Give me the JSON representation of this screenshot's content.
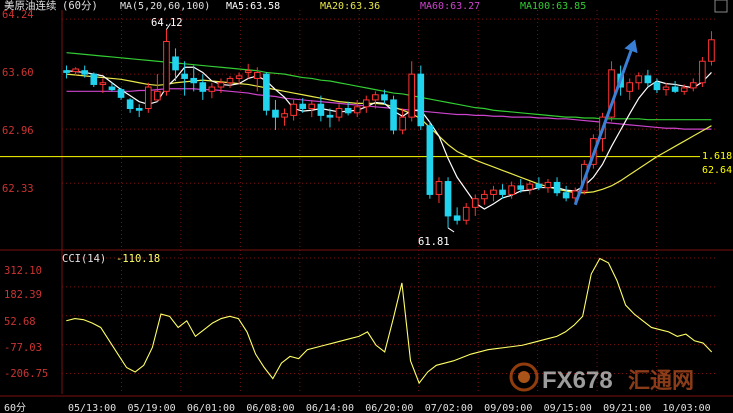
{
  "header": {
    "symbol": "美原油连续",
    "period": "(60分)",
    "ma_params": "MA(5,20,60,100)",
    "ma5": "MA5:63.58",
    "ma20": "MA20:63.36",
    "ma60": "MA60:63.27",
    "ma100": "MA100:63.85"
  },
  "colors": {
    "ma5": "#ffffff",
    "ma20": "#e8e84a",
    "ma60": "#cc44cc",
    "ma100": "#33cc33",
    "up": "#ff3333",
    "down": "#22d3ee",
    "grid": "#7a1010",
    "axis_text": "#cc3333",
    "cci": "#ffff66",
    "level_line": "#ffff00",
    "arrow": "#3a7fd6"
  },
  "price_axis": {
    "ticks": [
      "64.24",
      "63.60",
      "62.96",
      "62.33"
    ],
    "range": [
      61.6,
      64.3
    ]
  },
  "annotations": {
    "high_label": "64.12",
    "low_label": "61.81",
    "level_value": "1.618",
    "level_price": "62.64"
  },
  "cci": {
    "title": "CCI(14)",
    "value": "-110.18",
    "ticks": [
      "312.10",
      "182.39",
      "52.68",
      "-77.03",
      "-206.75"
    ],
    "range": [
      -290,
      330
    ]
  },
  "period_label": "60分",
  "watermark": {
    "brand": "FX678",
    "cn": "汇通网"
  },
  "time_axis": [
    "05/13:00",
    "05/19:00",
    "06/01:00",
    "06/08:00",
    "06/14:00",
    "06/20:00",
    "07/02:00",
    "09/09:00",
    "09/15:00",
    "09/21:00",
    "10/03:00"
  ],
  "chart_data": {
    "type": "candlestick",
    "candles": [
      {
        "o": 63.64,
        "h": 63.7,
        "l": 63.55,
        "c": 63.62
      },
      {
        "o": 63.63,
        "h": 63.68,
        "l": 63.58,
        "c": 63.66
      },
      {
        "o": 63.64,
        "h": 63.7,
        "l": 63.56,
        "c": 63.6
      },
      {
        "o": 63.6,
        "h": 63.62,
        "l": 63.45,
        "c": 63.48
      },
      {
        "o": 63.48,
        "h": 63.55,
        "l": 63.38,
        "c": 63.5
      },
      {
        "o": 63.45,
        "h": 63.5,
        "l": 63.4,
        "c": 63.42
      },
      {
        "o": 63.42,
        "h": 63.44,
        "l": 63.3,
        "c": 63.33
      },
      {
        "o": 63.3,
        "h": 63.32,
        "l": 63.15,
        "c": 63.2
      },
      {
        "o": 63.2,
        "h": 63.25,
        "l": 63.1,
        "c": 63.18
      },
      {
        "o": 63.2,
        "h": 63.5,
        "l": 63.15,
        "c": 63.45
      },
      {
        "o": 63.3,
        "h": 63.6,
        "l": 63.28,
        "c": 63.4
      },
      {
        "o": 63.4,
        "h": 64.12,
        "l": 63.35,
        "c": 63.98
      },
      {
        "o": 63.8,
        "h": 63.9,
        "l": 63.52,
        "c": 63.65
      },
      {
        "o": 63.6,
        "h": 63.75,
        "l": 63.35,
        "c": 63.55
      },
      {
        "o": 63.55,
        "h": 63.7,
        "l": 63.4,
        "c": 63.5
      },
      {
        "o": 63.5,
        "h": 63.6,
        "l": 63.3,
        "c": 63.4
      },
      {
        "o": 63.4,
        "h": 63.5,
        "l": 63.32,
        "c": 63.45
      },
      {
        "o": 63.45,
        "h": 63.55,
        "l": 63.38,
        "c": 63.5
      },
      {
        "o": 63.5,
        "h": 63.58,
        "l": 63.44,
        "c": 63.55
      },
      {
        "o": 63.55,
        "h": 63.62,
        "l": 63.48,
        "c": 63.58
      },
      {
        "o": 63.62,
        "h": 63.72,
        "l": 63.55,
        "c": 63.64
      },
      {
        "o": 63.55,
        "h": 63.68,
        "l": 63.4,
        "c": 63.62
      },
      {
        "o": 63.6,
        "h": 63.62,
        "l": 63.12,
        "c": 63.18
      },
      {
        "o": 63.18,
        "h": 63.3,
        "l": 62.95,
        "c": 63.1
      },
      {
        "o": 63.1,
        "h": 63.2,
        "l": 63.0,
        "c": 63.14
      },
      {
        "o": 63.12,
        "h": 63.3,
        "l": 63.06,
        "c": 63.25
      },
      {
        "o": 63.25,
        "h": 63.32,
        "l": 63.15,
        "c": 63.2
      },
      {
        "o": 63.2,
        "h": 63.3,
        "l": 63.1,
        "c": 63.25
      },
      {
        "o": 63.25,
        "h": 63.35,
        "l": 63.05,
        "c": 63.12
      },
      {
        "o": 63.12,
        "h": 63.2,
        "l": 62.98,
        "c": 63.1
      },
      {
        "o": 63.1,
        "h": 63.25,
        "l": 63.05,
        "c": 63.2
      },
      {
        "o": 63.2,
        "h": 63.28,
        "l": 63.12,
        "c": 63.15
      },
      {
        "o": 63.15,
        "h": 63.3,
        "l": 63.1,
        "c": 63.22
      },
      {
        "o": 63.22,
        "h": 63.35,
        "l": 63.15,
        "c": 63.3
      },
      {
        "o": 63.3,
        "h": 63.4,
        "l": 63.2,
        "c": 63.36
      },
      {
        "o": 63.36,
        "h": 63.42,
        "l": 63.25,
        "c": 63.3
      },
      {
        "o": 63.3,
        "h": 63.35,
        "l": 62.9,
        "c": 62.95
      },
      {
        "o": 62.95,
        "h": 63.2,
        "l": 62.9,
        "c": 63.1
      },
      {
        "o": 63.1,
        "h": 63.75,
        "l": 63.05,
        "c": 63.6
      },
      {
        "o": 63.6,
        "h": 63.7,
        "l": 62.95,
        "c": 63.0
      },
      {
        "o": 63.0,
        "h": 63.05,
        "l": 62.15,
        "c": 62.2
      },
      {
        "o": 62.2,
        "h": 62.4,
        "l": 62.1,
        "c": 62.35
      },
      {
        "o": 62.35,
        "h": 62.4,
        "l": 61.81,
        "c": 61.95
      },
      {
        "o": 61.95,
        "h": 62.05,
        "l": 61.85,
        "c": 61.9
      },
      {
        "o": 61.9,
        "h": 62.1,
        "l": 61.85,
        "c": 62.05
      },
      {
        "o": 62.05,
        "h": 62.2,
        "l": 61.95,
        "c": 62.15
      },
      {
        "o": 62.15,
        "h": 62.25,
        "l": 62.08,
        "c": 62.2
      },
      {
        "o": 62.2,
        "h": 62.3,
        "l": 62.12,
        "c": 62.25
      },
      {
        "o": 62.25,
        "h": 62.32,
        "l": 62.15,
        "c": 62.2
      },
      {
        "o": 62.2,
        "h": 62.35,
        "l": 62.15,
        "c": 62.3
      },
      {
        "o": 62.3,
        "h": 62.38,
        "l": 62.22,
        "c": 62.26
      },
      {
        "o": 62.26,
        "h": 62.35,
        "l": 62.2,
        "c": 62.32
      },
      {
        "o": 62.32,
        "h": 62.4,
        "l": 62.25,
        "c": 62.28
      },
      {
        "o": 62.28,
        "h": 62.38,
        "l": 62.22,
        "c": 62.34
      },
      {
        "o": 62.34,
        "h": 62.4,
        "l": 62.18,
        "c": 62.22
      },
      {
        "o": 62.22,
        "h": 62.3,
        "l": 62.12,
        "c": 62.16
      },
      {
        "o": 62.16,
        "h": 62.28,
        "l": 62.1,
        "c": 62.24
      },
      {
        "o": 62.24,
        "h": 62.6,
        "l": 62.2,
        "c": 62.55
      },
      {
        "o": 62.55,
        "h": 62.9,
        "l": 62.5,
        "c": 62.85
      },
      {
        "o": 62.85,
        "h": 63.15,
        "l": 62.7,
        "c": 63.1
      },
      {
        "o": 63.1,
        "h": 63.75,
        "l": 63.05,
        "c": 63.65
      },
      {
        "o": 63.6,
        "h": 63.7,
        "l": 63.35,
        "c": 63.45
      },
      {
        "o": 63.4,
        "h": 63.55,
        "l": 63.3,
        "c": 63.5
      },
      {
        "o": 63.5,
        "h": 63.62,
        "l": 63.42,
        "c": 63.58
      },
      {
        "o": 63.58,
        "h": 63.65,
        "l": 63.45,
        "c": 63.5
      },
      {
        "o": 63.5,
        "h": 63.55,
        "l": 63.38,
        "c": 63.42
      },
      {
        "o": 63.42,
        "h": 63.5,
        "l": 63.35,
        "c": 63.45
      },
      {
        "o": 63.45,
        "h": 63.52,
        "l": 63.38,
        "c": 63.4
      },
      {
        "o": 63.4,
        "h": 63.48,
        "l": 63.36,
        "c": 63.44
      },
      {
        "o": 63.44,
        "h": 63.55,
        "l": 63.4,
        "c": 63.5
      },
      {
        "o": 63.5,
        "h": 63.8,
        "l": 63.45,
        "c": 63.75
      },
      {
        "o": 63.75,
        "h": 64.1,
        "l": 63.7,
        "c": 64.0
      }
    ],
    "ma5": [
      63.64,
      63.63,
      63.62,
      63.6,
      63.58,
      63.5,
      63.42,
      63.35,
      63.28,
      63.25,
      63.28,
      63.45,
      63.55,
      63.68,
      63.68,
      63.62,
      63.52,
      63.48,
      63.47,
      63.49,
      63.55,
      63.58,
      63.52,
      63.42,
      63.33,
      63.2,
      63.17,
      63.18,
      63.2,
      63.18,
      63.16,
      63.17,
      63.18,
      63.22,
      63.27,
      63.26,
      63.17,
      63.11,
      63.18,
      63.18,
      63.04,
      62.88,
      62.62,
      62.4,
      62.25,
      62.1,
      62.03,
      62.09,
      62.16,
      62.19,
      62.24,
      62.25,
      62.28,
      62.28,
      62.28,
      62.25,
      62.24,
      62.3,
      62.4,
      62.55,
      62.76,
      62.95,
      63.14,
      63.32,
      63.45,
      63.52,
      63.49,
      63.48,
      63.46,
      63.44,
      63.51,
      63.62
    ],
    "ma20": [
      63.6,
      63.59,
      63.58,
      63.57,
      63.56,
      63.55,
      63.54,
      63.52,
      63.5,
      63.48,
      63.47,
      63.48,
      63.5,
      63.51,
      63.52,
      63.53,
      63.52,
      63.51,
      63.5,
      63.49,
      63.48,
      63.46,
      63.44,
      63.42,
      63.4,
      63.38,
      63.36,
      63.34,
      63.32,
      63.3,
      63.28,
      63.27,
      63.26,
      63.26,
      63.26,
      63.25,
      63.22,
      63.18,
      63.14,
      63.08,
      62.98,
      62.88,
      62.78,
      62.7,
      62.65,
      62.6,
      62.56,
      62.52,
      62.48,
      62.44,
      62.4,
      62.36,
      62.32,
      62.29,
      62.26,
      62.24,
      62.22,
      62.22,
      62.23,
      62.26,
      62.3,
      62.36,
      62.43,
      62.5,
      62.57,
      62.64,
      62.7,
      62.76,
      62.82,
      62.88,
      62.94,
      63.0
    ],
    "ma60": [
      63.4,
      63.4,
      63.4,
      63.4,
      63.4,
      63.4,
      63.4,
      63.4,
      63.41,
      63.41,
      63.42,
      63.43,
      63.43,
      63.43,
      63.43,
      63.42,
      63.42,
      63.41,
      63.4,
      63.39,
      63.38,
      63.36,
      63.35,
      63.34,
      63.32,
      63.31,
      63.3,
      63.29,
      63.28,
      63.27,
      63.26,
      63.25,
      63.24,
      63.23,
      63.22,
      63.21,
      63.2,
      63.19,
      63.18,
      63.17,
      63.16,
      63.15,
      63.14,
      63.13,
      63.13,
      63.12,
      63.12,
      63.11,
      63.11,
      63.1,
      63.1,
      63.1,
      63.09,
      63.09,
      63.08,
      63.08,
      63.07,
      63.06,
      63.05,
      63.04,
      63.03,
      63.02,
      63.01,
      63.0,
      62.99,
      62.98,
      62.97,
      62.97,
      62.96,
      62.96,
      62.96,
      62.96
    ],
    "ma100": [
      63.85,
      63.84,
      63.83,
      63.82,
      63.81,
      63.8,
      63.79,
      63.78,
      63.77,
      63.76,
      63.75,
      63.74,
      63.73,
      63.72,
      63.71,
      63.7,
      63.69,
      63.68,
      63.67,
      63.66,
      63.65,
      63.64,
      63.62,
      63.61,
      63.6,
      63.58,
      63.56,
      63.55,
      63.53,
      63.52,
      63.5,
      63.48,
      63.46,
      63.44,
      63.42,
      63.4,
      63.38,
      63.37,
      63.35,
      63.33,
      63.31,
      63.29,
      63.27,
      63.25,
      63.23,
      63.21,
      63.2,
      63.18,
      63.17,
      63.16,
      63.15,
      63.14,
      63.13,
      63.12,
      63.11,
      63.1,
      63.1,
      63.09,
      63.09,
      63.08,
      63.08,
      63.08,
      63.08,
      63.08,
      63.07,
      63.07,
      63.07,
      63.07,
      63.07,
      63.07,
      63.07,
      63.07
    ],
    "cci": [
      30,
      40,
      35,
      20,
      0,
      -60,
      -120,
      -180,
      -200,
      -170,
      -90,
      60,
      50,
      0,
      30,
      -40,
      -10,
      20,
      40,
      50,
      40,
      -20,
      -120,
      -180,
      -230,
      -160,
      -130,
      -140,
      -100,
      -90,
      -80,
      -70,
      -60,
      -50,
      -40,
      -20,
      -80,
      -110,
      40,
      200,
      -150,
      -250,
      -200,
      -170,
      -160,
      -150,
      -135,
      -120,
      -110,
      -100,
      -95,
      -90,
      -85,
      -80,
      -70,
      -60,
      -50,
      -40,
      -20,
      10,
      50,
      240,
      310,
      290,
      210,
      100,
      60,
      30,
      0,
      -10,
      -20,
      -40,
      -30,
      -60,
      -70,
      -110.18
    ]
  }
}
